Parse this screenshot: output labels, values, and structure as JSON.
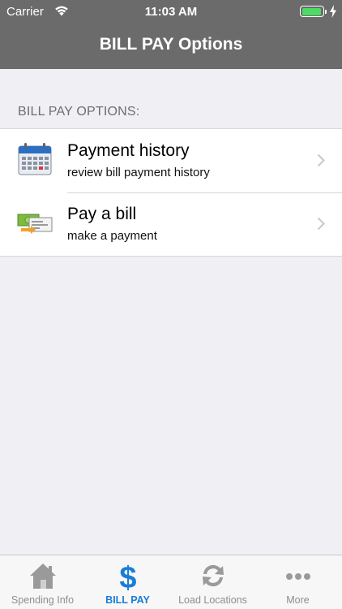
{
  "status_bar": {
    "carrier": "Carrier",
    "time": "11:03 AM",
    "battery_percent": 80
  },
  "nav": {
    "title": "BILL PAY Options"
  },
  "section": {
    "header": "BILL PAY OPTIONS:",
    "items": [
      {
        "title": "Payment history",
        "subtitle": "review bill payment history",
        "icon": "calendar-icon"
      },
      {
        "title": "Pay a bill",
        "subtitle": "make a payment",
        "icon": "cash-payment-icon"
      }
    ]
  },
  "tabbar": {
    "tabs": [
      {
        "label": "Spending Info",
        "icon": "house-icon",
        "active": false
      },
      {
        "label": "BILL PAY",
        "icon": "dollar-icon",
        "active": true
      },
      {
        "label": "Load Locations",
        "icon": "refresh-icon",
        "active": false
      },
      {
        "label": "More",
        "icon": "more-icon",
        "active": false
      }
    ]
  },
  "colors": {
    "nav_background": "#6b6b6b",
    "active_tab": "#1a7dd7",
    "battery_fill": "#4cd964",
    "page_background": "#efeff4"
  }
}
